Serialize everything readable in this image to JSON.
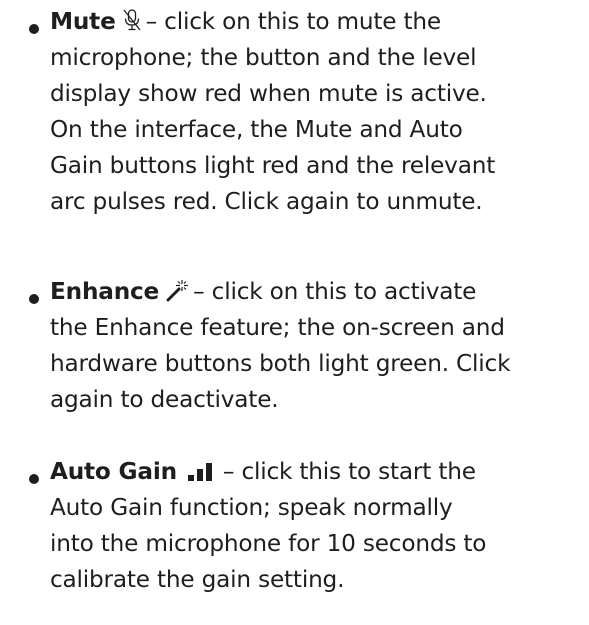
{
  "items": [
    {
      "term": "Mute",
      "icon": "muted-microphone-icon",
      "lines": [
        "– click on this to mute the",
        "microphone; the button and the level",
        "display show red when mute is active.",
        "On the interface, the Mute and Auto",
        "Gain buttons light red and the relevant",
        "arc pulses red.  Click again to unmute."
      ]
    },
    {
      "term": "Enhance",
      "icon": "magic-wand-icon",
      "lines": [
        "– click on this to activate",
        "the Enhance feature; the on-screen and",
        "hardware buttons both light green. Click",
        "again to deactivate."
      ]
    },
    {
      "term": "Auto Gain",
      "icon": "level-bars-icon",
      "lines": [
        "– click this to start the",
        "Auto Gain function; speak normally",
        "into the microphone for 10 seconds to",
        "calibrate the gain setting."
      ]
    }
  ],
  "colors": {
    "text": "#1e1e1e"
  }
}
